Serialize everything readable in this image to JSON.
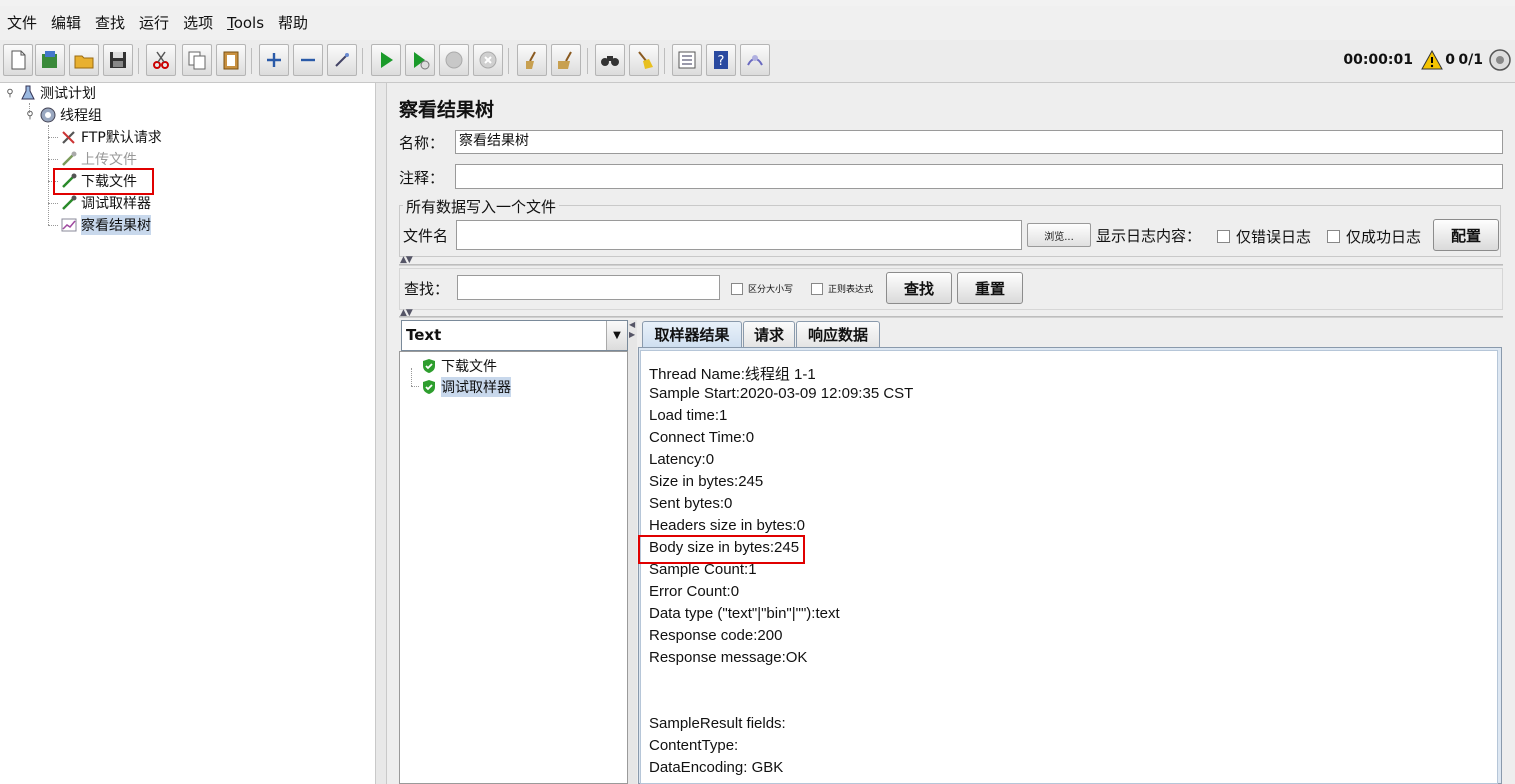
{
  "menu": [
    {
      "label": "文件"
    },
    {
      "label": "编辑"
    },
    {
      "label": "查找"
    },
    {
      "label": "运行"
    },
    {
      "label": "选项"
    },
    {
      "label": "Tools",
      "underline": "T"
    },
    {
      "label": "帮助"
    }
  ],
  "status": {
    "timer": "00:00:01",
    "error_count": "0",
    "threads": "0/1"
  },
  "tree": {
    "items": [
      {
        "label": "测试计划",
        "icon": "flask-icon"
      },
      {
        "label": "线程组",
        "icon": "gear-icon"
      },
      {
        "label": "FTP默认请求",
        "icon": "wrench-icon"
      },
      {
        "label": "上传文件",
        "icon": "pipette-icon",
        "disabled": true
      },
      {
        "label": "下载文件",
        "icon": "pipette-icon",
        "highlighted": true
      },
      {
        "label": "调试取样器",
        "icon": "pipette-icon"
      },
      {
        "label": "察看结果树",
        "icon": "chart-icon",
        "selected": true
      }
    ]
  },
  "panel": {
    "title": "察看结果树",
    "name_label": "名称：",
    "name_value": "察看结果树",
    "comment_label": "注释：",
    "comment_value": "",
    "file_group_title": "所有数据写入一个文件",
    "file_label": "文件名",
    "file_value": "",
    "browse_label": "浏览...",
    "log_label": "显示日志内容：",
    "errors_only_label": "仅错误日志",
    "success_only_label": "仅成功日志",
    "configure_label": "配置",
    "search_label": "查找：",
    "search_value": "",
    "case_label": "区分大小写",
    "regex_label": "正则表达式",
    "find_label": "查找",
    "reset_label": "重置"
  },
  "results": {
    "renderer": "Text",
    "items": [
      {
        "label": "下载文件",
        "status": "success"
      },
      {
        "label": "调试取样器",
        "status": "success",
        "selected": true
      }
    ],
    "tabs": [
      {
        "label": "取样器结果",
        "active": true
      },
      {
        "label": "请求"
      },
      {
        "label": "响应数据"
      }
    ],
    "lines": [
      "Thread Name:线程组 1-1",
      "Sample Start:2020-03-09 12:09:35 CST",
      "Load time:1",
      "Connect Time:0",
      "Latency:0",
      "Size in bytes:245",
      "Sent bytes:0",
      "Headers size in bytes:0",
      "Body size in bytes:245",
      "Sample Count:1",
      "Error Count:0",
      "Data type (\"text\"|\"bin\"|\"\"):text",
      "Response code:200",
      "Response message:OK",
      "",
      "",
      "SampleResult fields:",
      "ContentType:",
      "DataEncoding: GBK"
    ]
  },
  "colors": {
    "highlight_box": "#e00000",
    "selection": "#c8d8ec",
    "success": "#2e9e2e"
  }
}
